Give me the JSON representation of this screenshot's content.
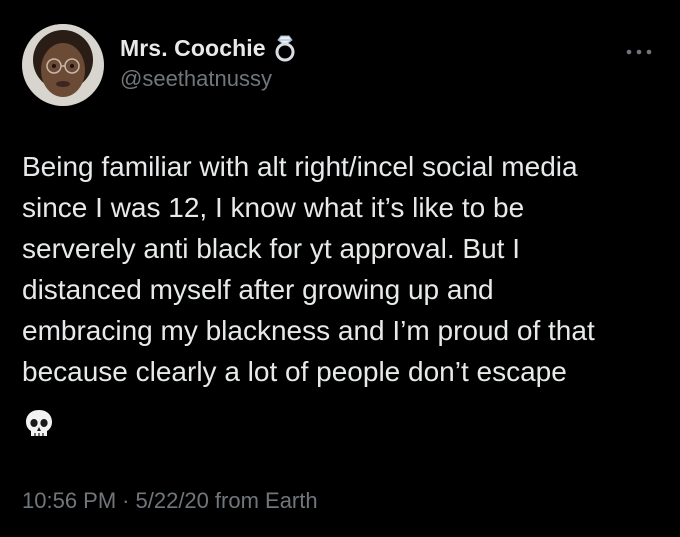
{
  "tweet": {
    "author": {
      "display_name": "Mrs. Coochie",
      "handle": "@seethatnussy",
      "badge_icon": "ring-icon",
      "avatar": "avatar-photo"
    },
    "more_icon": "more-horizontal-icon",
    "text": "Being familiar with alt right/incel social media\nsince I was 12, I know what it’s like to be\nserverely anti black for yt approval. But I\ndistanced myself after growing up and\nembracing my blackness and I’m proud of that\nbecause clearly a lot of people don’t escape",
    "emoji": "skull-icon",
    "meta": {
      "time": "10:56 PM",
      "separator": "·",
      "date": "5/22/20",
      "source": "from Earth"
    }
  },
  "colors": {
    "background": "#000000",
    "text_primary": "#e7e9ea",
    "text_secondary": "#71767b"
  }
}
